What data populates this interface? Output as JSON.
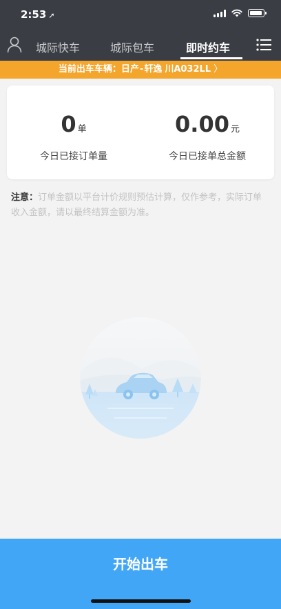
{
  "status_bar": {
    "time": "2:53",
    "location_arrow": "➚"
  },
  "nav": {
    "tabs": [
      {
        "label": "城际快车",
        "active": false
      },
      {
        "label": "城际包车",
        "active": false
      },
      {
        "label": "即时约车",
        "active": true
      }
    ],
    "user_icon": "user-icon",
    "menu_icon": "list-menu-icon"
  },
  "vehicle_bar": {
    "prefix": "当前出车车辆：",
    "brand": "日产",
    "separator": "-",
    "model": "轩逸",
    "plate": "川A032LL",
    "chevron": "〉"
  },
  "stats": {
    "orders": {
      "value": "0",
      "unit": "单",
      "label": "今日已接订单量"
    },
    "amount": {
      "value": "0.00",
      "unit": "元",
      "label": "今日已接单总金额"
    }
  },
  "notice": {
    "label": "注意：",
    "text": "订单金额以平台计价规则预估计算，仅作参考，实际订单收入金额，请以最终结算金额为准。"
  },
  "empty_state": {
    "illustration": "car-landscape-illustration"
  },
  "action": {
    "start_label": "开始出车"
  },
  "colors": {
    "header": "#3a3d44",
    "vehicle_bar": "#f4a52c",
    "primary_button": "#42a6f7",
    "background": "#f3f3f3"
  }
}
